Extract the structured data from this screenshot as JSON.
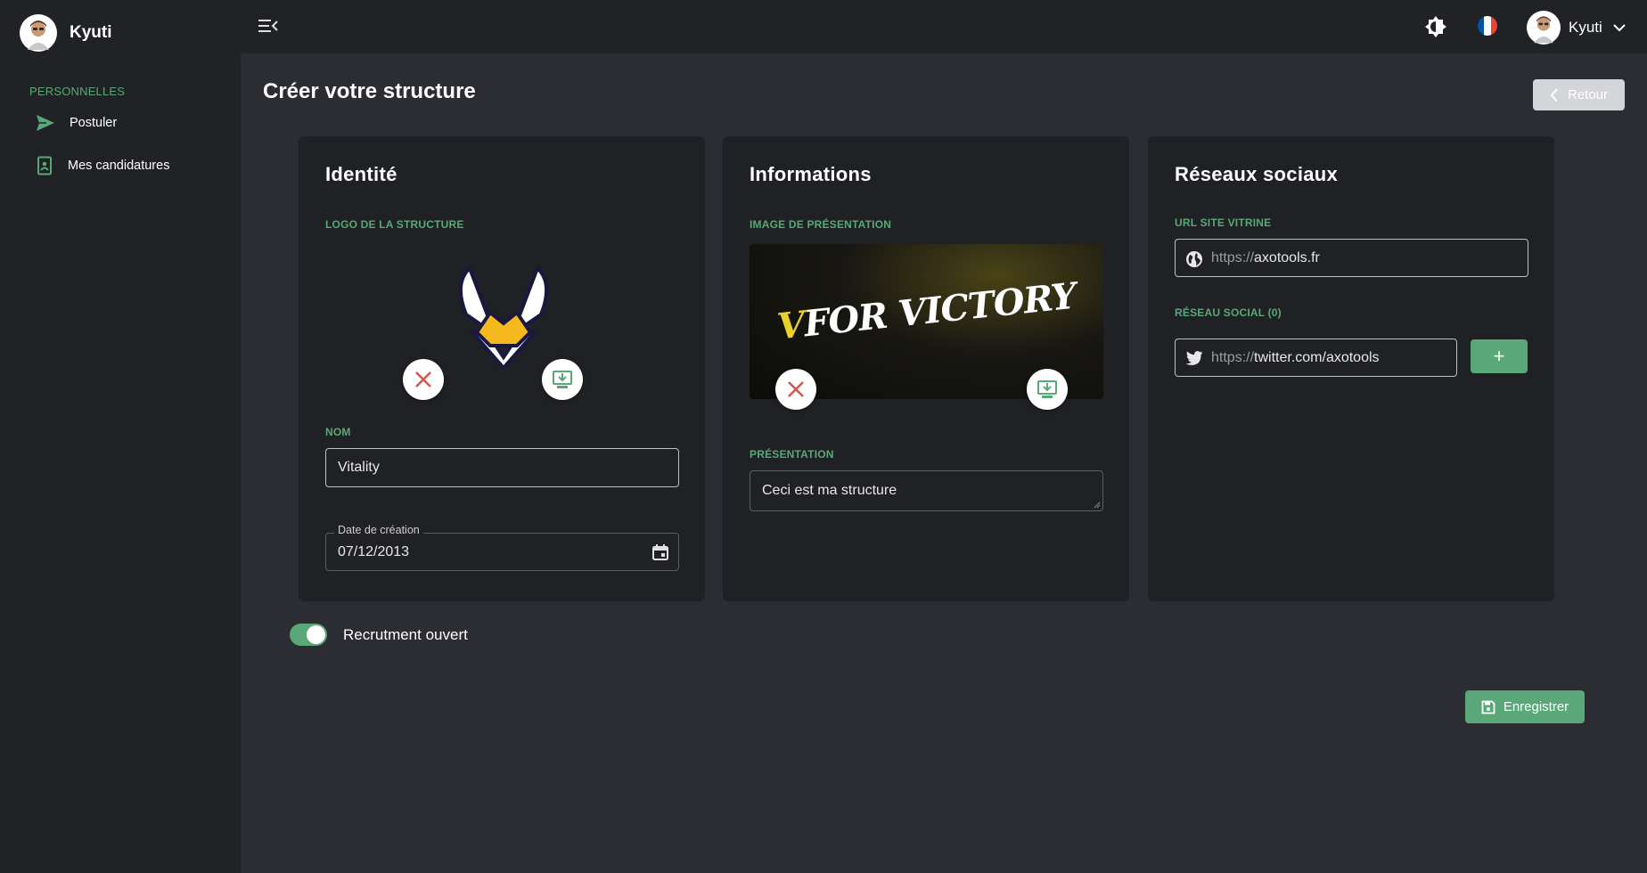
{
  "sidebar": {
    "brand_name": "Kyuti",
    "section_label": "PERSONNELLES",
    "items": [
      {
        "label": "Postuler",
        "icon": "send-icon"
      },
      {
        "label": "Mes candidatures",
        "icon": "document-icon"
      }
    ]
  },
  "topbar": {
    "user_name": "Kyuti",
    "language": "fr",
    "flag_colors": [
      "#0055a4",
      "#ffffff",
      "#ef4135"
    ]
  },
  "page": {
    "title": "Créer votre structure",
    "back_label": "Retour"
  },
  "identity": {
    "title": "Identité",
    "logo_label": "LOGO DE LA STRUCTURE",
    "name_label": "NOM",
    "name_value": "Vitality",
    "date_label": "Date de création",
    "date_value": "07/12/2013"
  },
  "informations": {
    "title": "Informations",
    "image_label": "IMAGE DE PRÉSENTATION",
    "banner_text_v": "V",
    "banner_text_rest": "FOR VICTORY",
    "presentation_label": "PRÉSENTATION",
    "presentation_value": "Ceci est ma structure"
  },
  "social": {
    "title": "Réseaux sociaux",
    "site_label": "URL SITE VITRINE",
    "site_prefix": "https://",
    "site_value": "axotools.fr",
    "network_label": "RÉSEAU SOCIAL (0)",
    "network_prefix": "https://",
    "network_value": "twitter.com/axotools",
    "add_label": "+"
  },
  "recruitment": {
    "label": "Recrutment ouvert",
    "enabled": true
  },
  "actions": {
    "save_label": "Enregistrer"
  },
  "colors": {
    "accent": "#5aa877",
    "danger": "#d9534f",
    "background": "#2c2d32",
    "panel": "#212226"
  }
}
